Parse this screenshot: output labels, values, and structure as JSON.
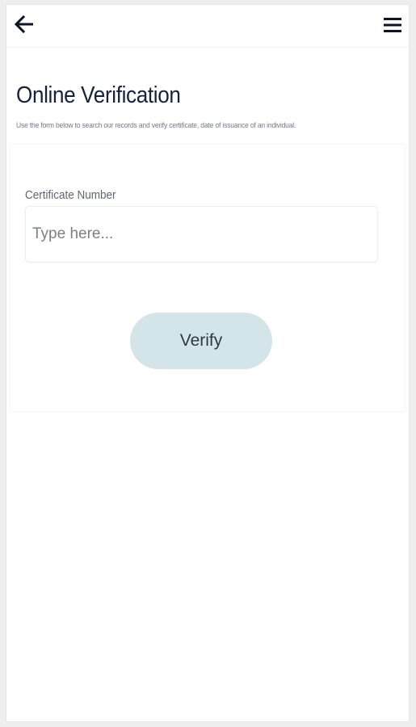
{
  "header": {
    "back_icon": "arrow-left-icon",
    "menu_icon": "hamburger-menu-icon"
  },
  "page": {
    "title": "Online Verification",
    "subtitle": "Use the form below to search our records and verify certificate, date of issuance of an individual."
  },
  "form": {
    "certificate_label": "Certificate Number",
    "certificate_placeholder": "Type here...",
    "certificate_value": "",
    "verify_label": "Verify"
  },
  "colors": {
    "title": "#16213a",
    "button_bg": "#d4e5ea",
    "button_text": "#2d3845",
    "background": "#ffffff"
  }
}
